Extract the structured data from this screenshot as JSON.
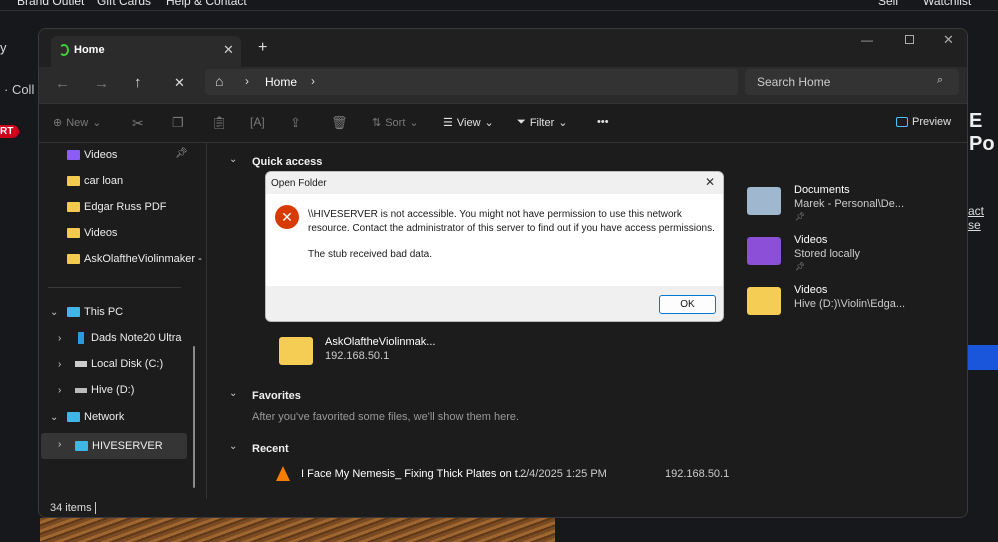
{
  "background_page": {
    "nav": [
      "Brand Outlet",
      "Gift Cards",
      "Help & Contact",
      "Sell",
      "Watchlist"
    ],
    "left_fragments": [
      "y",
      "· Coll"
    ],
    "badge": "RT",
    "right_fragments": [
      "E Po",
      "act se"
    ]
  },
  "explorer": {
    "tab_title": "Home",
    "new_tab": "+",
    "breadcrumb": "Home",
    "search_placeholder": "Search Home",
    "toolbar": {
      "new": "New",
      "sort": "Sort",
      "view": "View",
      "filter": "Filter",
      "more": "•••",
      "preview": "Preview"
    },
    "sidebar": {
      "pinned": [
        {
          "label": "Videos",
          "type": "video"
        },
        {
          "label": "car loan"
        },
        {
          "label": "Edgar Russ PDF"
        },
        {
          "label": "Videos"
        },
        {
          "label": "AskOlaftheViolinmaker -"
        }
      ],
      "this_pc": "This PC",
      "drives": [
        "Dads Note20 Ultra",
        "Local Disk (C:)",
        "Hive (D:)"
      ],
      "network": "Network",
      "server": "HIVESERVER"
    },
    "quick_access": {
      "title": "Quick access",
      "items": [
        {
          "name": "Documents",
          "sub": "Marek - Personal\\De..."
        },
        {
          "name": "Videos",
          "sub": "Stored locally"
        },
        {
          "name": "Videos",
          "sub": "Hive (D:)\\Violin\\Edga..."
        },
        {
          "name": "AskOlaftheViolinmak...",
          "sub": "192.168.50.1"
        }
      ]
    },
    "favorites": {
      "title": "Favorites",
      "empty": "After you've favorited some files, we'll show them here."
    },
    "recent": {
      "title": "Recent",
      "items": [
        {
          "name": "I Face My Nemesis_ Fixing Thick Plates on t...",
          "date": "2/4/2025 1:25 PM",
          "location": "192.168.50.1"
        }
      ]
    },
    "status": "34 items"
  },
  "dialog": {
    "title": "Open Folder",
    "message": "\\\\HIVESERVER is not accessible. You might not have permission to use this network resource. Contact the administrator of this server to find out if you have access permissions.",
    "detail": "The stub received bad data.",
    "ok": "OK"
  },
  "colors": {
    "accent": "#0078d4",
    "error": "#d83b01",
    "folder": "#f3c94e"
  }
}
